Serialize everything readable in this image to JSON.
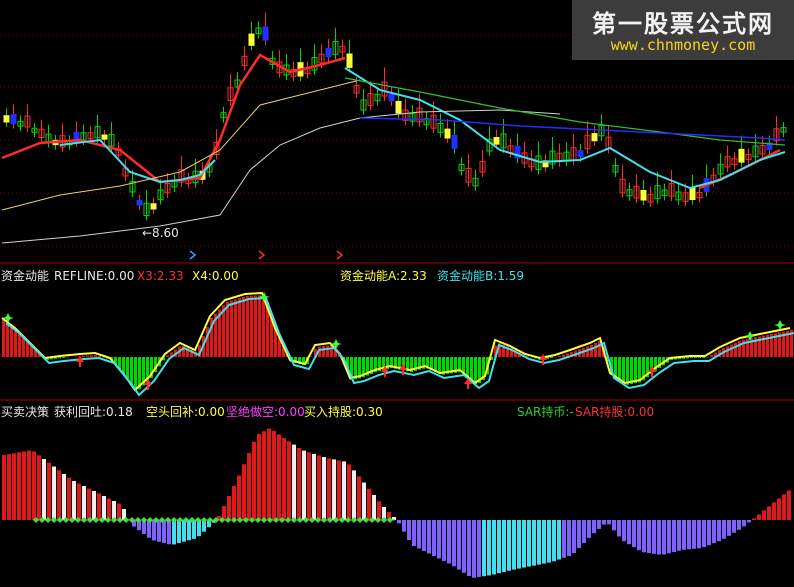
{
  "watermark": {
    "title": "第一股票公式网",
    "url": "www.chnmoney.com"
  },
  "annotations": {
    "low_price": "←8.60"
  },
  "panel2": {
    "title": "资金动能",
    "refline": "REFLINE:0.00",
    "x3": "X3:2.33",
    "x4": "X4:0.00",
    "a": "资金动能A:2.33",
    "b": "资金动能B:1.59"
  },
  "panel3": {
    "title": "买卖决策",
    "profit": "获利回吐:0.18",
    "short_cover": "空头回补:0.00",
    "strong_short": "坚绝做空:0.00",
    "buy_hold": "买入持股:0.30",
    "sar_hold": "SAR持币:-",
    "sar_stock": "SAR持股:0.00"
  },
  "colors": {
    "up": "#ff2a2a",
    "down": "#00d800",
    "cyan": "#40e0f0",
    "yellow": "#ffff40",
    "blue": "#2030ff",
    "green_ma": "#30c030",
    "bg_grid": "#7a0000",
    "purple": "#8060ff",
    "white": "#f0f0f0"
  },
  "icons": [
    "up-arrow-icon",
    "down-arrow-icon",
    "star-marker-icon",
    "dollar-marker-icon"
  ]
}
